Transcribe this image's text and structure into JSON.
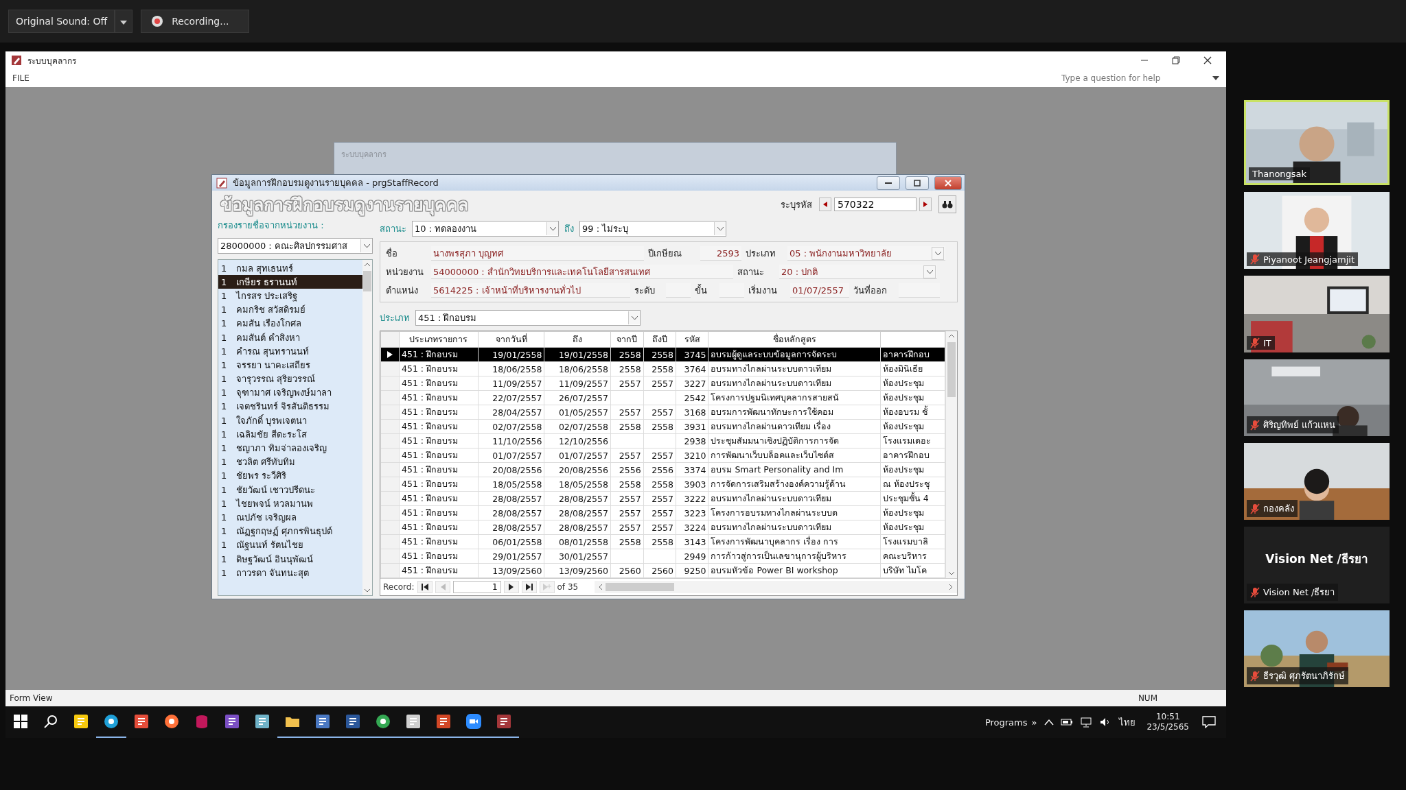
{
  "meeting_bar": {
    "sound_button": "Original Sound: Off",
    "recording": "Recording..."
  },
  "window": {
    "title": "ระบบบุคลากร",
    "menu": [
      "FILE"
    ],
    "help_placeholder": "Type a question for help"
  },
  "background_window": {
    "title": "ระบบบุคลากร"
  },
  "dialog": {
    "title": "ข้อมูลการฝึกอบรมดูงานรายบุคคล - prgStaffRecord",
    "heading": "ข้อมูลการฝึกอบรมดูงานรายบุคคล",
    "id_label": "ระบุรหัส",
    "id_value": "570322",
    "filter_label": "กรองรายชื่อจากหน่วยงาน :",
    "department_filter": "28000000 : คณะศิลปกรรมศาส",
    "status_label": "สถานะ",
    "status_from": "10 : ทดลองงาน",
    "to_label": "ถึง",
    "status_to": "99 : ไม่ระบุ",
    "staff_list": [
      {
        "num": "1",
        "name": "กมล  สุทเธนทร์",
        "selected": false
      },
      {
        "num": "1",
        "name": "เกษียร  ธรานนท์",
        "selected": true
      },
      {
        "num": "1",
        "name": "ไกรสร  ประเสริฐ",
        "selected": false
      },
      {
        "num": "1",
        "name": "คมกริช  สวัสดิรมย์",
        "selected": false
      },
      {
        "num": "1",
        "name": "คมสัน  เรืองโกศล",
        "selected": false
      },
      {
        "num": "1",
        "name": "คมสันต์  คำสิงหา",
        "selected": false
      },
      {
        "num": "1",
        "name": "คำรณ  สุนทรานนท์",
        "selected": false
      },
      {
        "num": "1",
        "name": "จรรยา  นาคะเสถียร",
        "selected": false
      },
      {
        "num": "1",
        "name": "จารุวรรณ  สุริยวรรณ์",
        "selected": false
      },
      {
        "num": "1",
        "name": "จุฑามาศ   เจริญพงษ์มาลา",
        "selected": false
      },
      {
        "num": "1",
        "name": "เจตชรินทร์  จิรสันติธรรม",
        "selected": false
      },
      {
        "num": "1",
        "name": "ใจภักดิ์  บุรพเจตนา",
        "selected": false
      },
      {
        "num": "1",
        "name": "เฉลิมชัย  สีดะระโส",
        "selected": false
      },
      {
        "num": "1",
        "name": "ชญาภา  ทิมจ่าลองเจริญ",
        "selected": false
      },
      {
        "num": "1",
        "name": "ชวลิต   ศรีทับทิม",
        "selected": false
      },
      {
        "num": "1",
        "name": "ชัยพร  ระวีศิริ",
        "selected": false
      },
      {
        "num": "1",
        "name": "ชัยวัฒน์  เชาวปรีดนะ",
        "selected": false
      },
      {
        "num": "1",
        "name": "ไชยพจน์  หวลมานพ",
        "selected": false
      },
      {
        "num": "1",
        "name": "ณปภัช  เจริญผล",
        "selected": false
      },
      {
        "num": "1",
        "name": "ณัฏฐกฤษฏ์  ศุภกรพินธุปต์",
        "selected": false
      },
      {
        "num": "1",
        "name": "ณัฐนนท์  รัตนไชย",
        "selected": false
      },
      {
        "num": "1",
        "name": "ดิษฐวัฒน์  อินนุพัฒน์",
        "selected": false
      },
      {
        "num": "1",
        "name": "ถาวรดา  จันทนะสุต",
        "selected": false
      }
    ],
    "details": [
      [
        {
          "label": "ชื่อ",
          "value": "นางพรสุภา บุญทศ",
          "kind": "text"
        },
        {
          "label": "ปีเกษียณ",
          "value": "2593",
          "kind": "number"
        },
        {
          "label": "ประเภท",
          "value": "05 : พนักงานมหาวิทยาลัย",
          "kind": "combo"
        }
      ],
      [
        {
          "label": "หน่วยงาน",
          "value": "54000000 : สำนักวิทยบริการและเทคโนโลยีสารสนเทศ",
          "kind": "text"
        },
        {
          "label": "สถานะ",
          "value": "20 : ปกติ",
          "kind": "combo"
        }
      ],
      [
        {
          "label": "ตำแหน่ง",
          "value": "5614225 : เจ้าหน้าที่บริหารงานทั่วไป",
          "kind": "text"
        },
        {
          "label": "ระดับ",
          "kind": "short"
        },
        {
          "label": "ขั้น",
          "kind": "short"
        },
        {
          "label": "เริ่มงาน",
          "value": "01/07/2557",
          "kind": "text"
        },
        {
          "label": "วันที่ออก",
          "kind": "short"
        }
      ]
    ],
    "type_label": "ประเภท",
    "type_value": "451 : ฝึกอบรม",
    "table": {
      "columns": [
        "ประเภทรายการ",
        "จากวันที่",
        "ถึง",
        "จากปี",
        "ถึงปี",
        "รหัส",
        "ชื่อหลักสูตร"
      ],
      "rows": [
        {
          "selected": true,
          "type": "451 : ฝึกอบรม",
          "from_date": "19/01/2558",
          "to_date": "19/01/2558",
          "from_year": "2558",
          "to_year": "2558",
          "code": "3745",
          "course": "อบรมผู้ดูแลระบบข้อมูลการจัดระบ",
          "column_8": "อาคารฝึกอบ"
        },
        {
          "selected": false,
          "type": "451 : ฝึกอบรม",
          "from_date": "18/06/2558",
          "to_date": "18/06/2558",
          "from_year": "2558",
          "to_year": "2558",
          "code": "3764",
          "course": "อบรมทางไกลผ่านระบบดาวเทียม",
          "column_8": "ห้องมินิเธีย"
        },
        {
          "selected": false,
          "type": "451 : ฝึกอบรม",
          "from_date": "11/09/2557",
          "to_date": "11/09/2557",
          "from_year": "2557",
          "to_year": "2557",
          "code": "3227",
          "course": "อบรมทางไกลผ่านระบบดาวเทียม",
          "column_8": "ห้องประชุม"
        },
        {
          "selected": false,
          "type": "451 : ฝึกอบรม",
          "from_date": "22/07/2557",
          "to_date": "26/07/2557",
          "code": "2542",
          "course": "โครงการปฐมนิเทศบุคลากรสายสนั",
          "column_8": "ห้องประชุม"
        },
        {
          "selected": false,
          "type": "451 : ฝึกอบรม",
          "from_date": "28/04/2557",
          "to_date": "01/05/2557",
          "from_year": "2557",
          "to_year": "2557",
          "code": "3168",
          "course": "อบรมการพัฒนาทักษะการใช้คอม",
          "column_8": "ห้องอบรม ชั้"
        },
        {
          "selected": false,
          "type": "451 : ฝึกอบรม",
          "from_date": "02/07/2558",
          "to_date": "02/07/2558",
          "from_year": "2558",
          "to_year": "2558",
          "code": "3931",
          "course": "อบรมทางไกลผ่านดาวเทียม เรื่อง",
          "column_8": "ห้องประชุม"
        },
        {
          "selected": false,
          "type": "451 : ฝึกอบรม",
          "from_date": "11/10/2556",
          "to_date": "12/10/2556",
          "code": "2938",
          "course": "ประชุมสัมมนาเชิงปฏิบัติการการจัด",
          "column_8": "โรงแรมเดอะ"
        },
        {
          "selected": false,
          "type": "451 : ฝึกอบรม",
          "from_date": "01/07/2557",
          "to_date": "01/07/2557",
          "from_year": "2557",
          "to_year": "2557",
          "code": "3210",
          "course": "การพัฒนาเว็บบล็อคและเว็บไซต์ส",
          "column_8": "อาคารฝึกอบ"
        },
        {
          "selected": false,
          "type": "451 : ฝึกอบรม",
          "from_date": "20/08/2556",
          "to_date": "20/08/2556",
          "from_year": "2556",
          "to_year": "2556",
          "code": "3374",
          "course": "อบรม Smart Personality and Im",
          "column_8": "ห้องประชุม"
        },
        {
          "selected": false,
          "type": "451 : ฝึกอบรม",
          "from_date": "18/05/2558",
          "to_date": "18/05/2558",
          "from_year": "2558",
          "to_year": "2558",
          "code": "3903",
          "course": "การจัดการเสริมสร้างองค์ความรู้ด้าน",
          "column_8": "ณ ห้องประชุ"
        },
        {
          "selected": false,
          "type": "451 : ฝึกอบรม",
          "from_date": "28/08/2557",
          "to_date": "28/08/2557",
          "from_year": "2557",
          "to_year": "2557",
          "code": "3222",
          "course": "อบรมทางไกลผ่านระบบดาวเทียม",
          "column_8": "ประชุมชั้น 4"
        },
        {
          "selected": false,
          "type": "451 : ฝึกอบรม",
          "from_date": "28/08/2557",
          "to_date": "28/08/2557",
          "from_year": "2557",
          "to_year": "2557",
          "code": "3223",
          "course": "โครงการอบรมทางไกลผ่านระบบด",
          "column_8": "ห้องประชุม"
        },
        {
          "selected": false,
          "type": "451 : ฝึกอบรม",
          "from_date": "28/08/2557",
          "to_date": "28/08/2557",
          "from_year": "2557",
          "to_year": "2557",
          "code": "3224",
          "course": "อบรมทางไกลผ่านระบบดาวเทียม",
          "column_8": "ห้องประชุม"
        },
        {
          "selected": false,
          "type": "451 : ฝึกอบรม",
          "from_date": "06/01/2558",
          "to_date": "08/01/2558",
          "from_year": "2558",
          "to_year": "2558",
          "code": "3143",
          "course": "โครงการพัฒนาบุคลากร เรื่อง การ",
          "column_8": "โรงแรมบาลิ"
        },
        {
          "selected": false,
          "type": "451 : ฝึกอบรม",
          "from_date": "29/01/2557",
          "to_date": "30/01/2557",
          "code": "2949",
          "course": "การก้าวสู่การเป็นเลขานุการผู้บริหาร",
          "column_8": "คณะบริหาร"
        },
        {
          "selected": false,
          "type": "451 : ฝึกอบรม",
          "from_date": "13/09/2560",
          "to_date": "13/09/2560",
          "from_year": "2560",
          "to_year": "2560",
          "code": "9250",
          "course": "อบรมหัวข้อ Power BI  workshop",
          "column_8": "บริษัท ไมโค"
        }
      ]
    },
    "navigator": {
      "label": "Record:",
      "current": "1",
      "total": "of 35"
    }
  },
  "status_bar": {
    "left": "Form View",
    "right": "NUM"
  },
  "taskbar": {
    "apps": [
      {
        "kind": "start",
        "running": false
      },
      {
        "kind": "search",
        "running": false
      },
      {
        "kind": "notes",
        "running": false
      },
      {
        "kind": "edge",
        "running": true
      },
      {
        "kind": "slides-s",
        "running": false
      },
      {
        "kind": "firefox",
        "running": false
      },
      {
        "kind": "database",
        "running": false
      },
      {
        "kind": "studio",
        "running": false
      },
      {
        "kind": "pen",
        "running": false
      },
      {
        "kind": "folder",
        "running": true
      },
      {
        "kind": "network",
        "running": true
      },
      {
        "kind": "word",
        "running": true
      },
      {
        "kind": "chrome",
        "running": true
      },
      {
        "kind": "acrobat",
        "running": true
      },
      {
        "kind": "powerpoint",
        "running": true
      },
      {
        "kind": "zoom",
        "running": true
      },
      {
        "kind": "access",
        "running": true
      }
    ],
    "programs": "Programs",
    "more": "»",
    "language": "ไทย",
    "time": "10:51",
    "date": "23/5/2565"
  },
  "participants": [
    {
      "name": "Thanongsak",
      "kind": "video",
      "muted": false,
      "speaking": true
    },
    {
      "name": "Piyanoot Jeangjamjit",
      "kind": "video",
      "muted": true,
      "speaking": false
    },
    {
      "name": "IT",
      "kind": "video",
      "muted": true,
      "speaking": false
    },
    {
      "name": "ศิริญทิพย์ แก้วแหน",
      "kind": "video",
      "muted": true,
      "speaking": false
    },
    {
      "name": "กองคลัง",
      "kind": "video",
      "muted": true,
      "speaking": false
    },
    {
      "name": "Vision Net /ธีรยา",
      "display_name": "Vision Net /ธีรยา",
      "kind": "no_video",
      "muted": true,
      "speaking": false
    },
    {
      "name": "ธีรวุฒิ ศุภรัตนาภิรักษ์",
      "kind": "video",
      "muted": true,
      "speaking": false
    }
  ]
}
